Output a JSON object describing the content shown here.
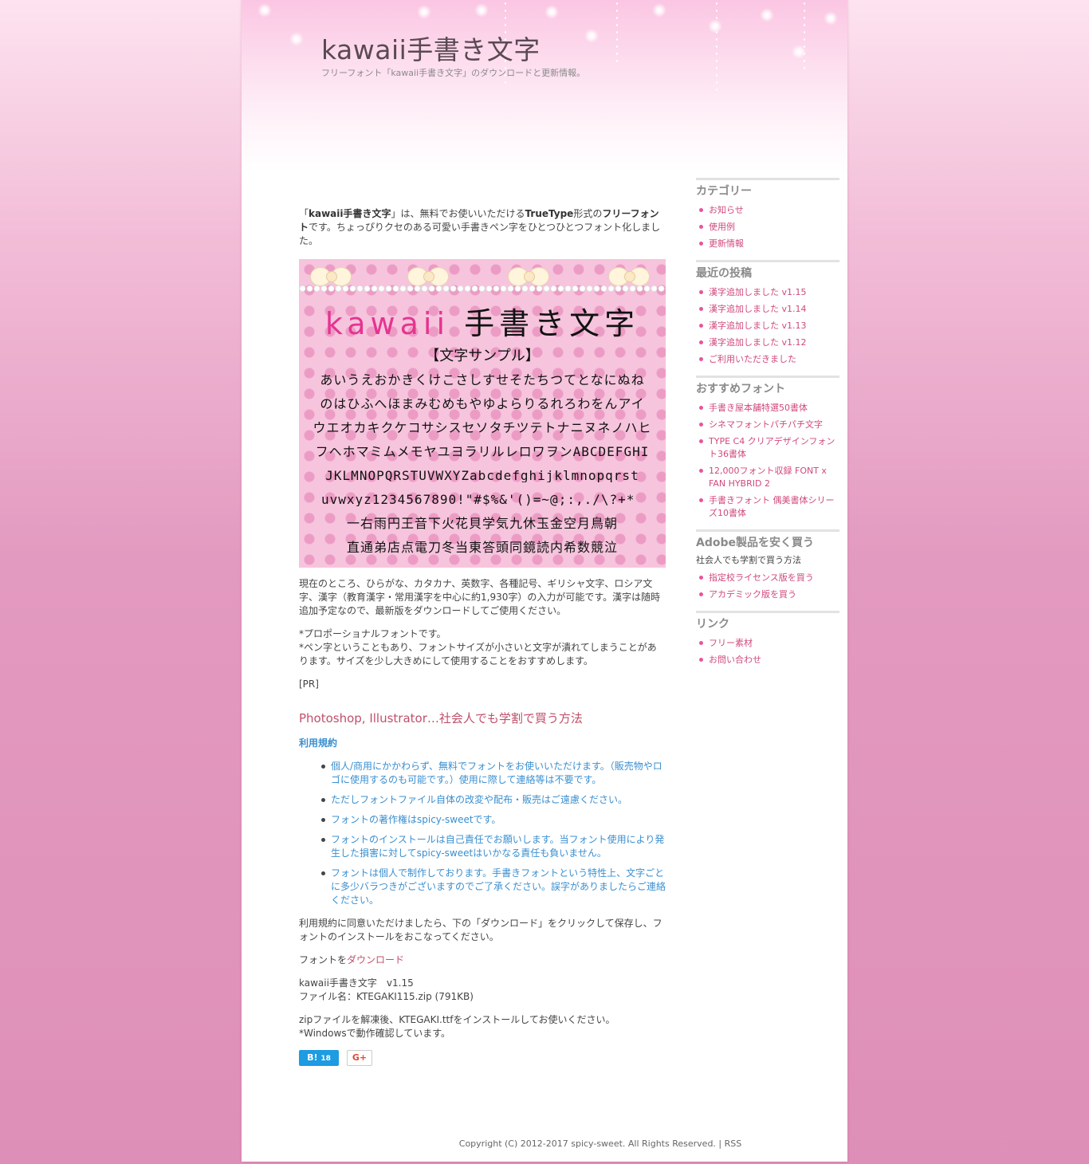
{
  "header": {
    "title": "kawaii手書き文字",
    "description": "フリーフォント「kawaii手書き文字」のダウンロードと更新情報。"
  },
  "intro": {
    "p1_a": "「",
    "p1_b": "kawaii手書き文字",
    "p1_c": "」は、無料でお使いいただける",
    "p1_d": "TrueType",
    "p1_e": "形式の",
    "p1_f": "フリーフォント",
    "p1_g": "です。ちょっぴりクセのある可愛い手書きペン字をひとつひとつフォント化しました。"
  },
  "sample": {
    "title_a": "kawaii",
    "title_b": "手書き文字",
    "subtitle": "【文字サンプル】",
    "lines": [
      "あいうえおかきくけこさしすせそたちつてとなにぬね",
      "のはひふへほまみむめもやゆよらりるれろわをんアイ",
      "ウエオカキクケコサシスセソタチツテトナニヌネノハヒ",
      "フヘホマミムメモヤユヨラリルレロワヲンABCDEFGHI",
      "JKLMNOPQRSTUVWXYZabcdefghijklmnopqrst",
      "uvwxyz1234567890!\"#$%&'()=~@;:,./\\?+*_",
      "一右雨円王音下火花貝学気九休玉金空月鳥朝",
      "直通弟店点電刀冬当東答頭同鏡読内希数競泣"
    ]
  },
  "body": {
    "p2": "現在のところ、ひらがな、カタカナ、英数字、各種記号、ギリシャ文字、ロシア文字、漢字（教育漢字・常用漢字を中心に約1,930字）の入力が可能です。漢字は随時追加予定なので、最新版をダウンロードしてご使用ください。",
    "p3_line1": "*プロポーショナルフォントです。",
    "p3_line2": "*ペン字ということもあり、フォントサイズが小さいと文字が潰れてしまうことがあります。サイズを少し大きめにして使用することをおすすめします。",
    "pr": "[PR]",
    "ad_heading": "Photoshop, Illustrator…社会人でも学割で買う方法",
    "terms_heading": "利用規約",
    "terms": [
      "個人/商用にかかわらず、無料でフォントをお使いいただけます。（販売物やロゴに使用するのも可能です。）使用に際して連絡等は不要です。",
      "ただしフォントファイル自体の改変や配布・販売はご遠慮ください。",
      "フォントの著作権はspicy-sweetです。",
      "フォントのインストールは自己責任でお願いします。当フォント使用により発生した損害に対してspicy-sweetはいかなる責任も負いません。",
      "フォントは個人で制作しております。手書きフォントという特性上、文字ごとに多少バラつきがございますのでご了承ください。誤字がありましたらご連絡ください。"
    ],
    "agree": "利用規約に同意いただけましたら、下の「ダウンロード」をクリックして保存し、フォントのインストールをおこなってください。",
    "download_prefix": "フォントを",
    "download_link": "ダウンロード",
    "version_line": "kawaii手書き文字　v1.15",
    "file_line": "ファイル名：KTEGAKI115.zip (791KB)",
    "install_line1": "zipファイルを解凍後、KTEGAKI.ttfをインストールしてお使いください。",
    "install_line2": "*Windowsで動作確認しています。"
  },
  "social": {
    "hatena_label": "B!",
    "hatena_count": "18",
    "gplus_label": "G+"
  },
  "sidebar": {
    "categories": {
      "title": "カテゴリー",
      "items": [
        "お知らせ",
        "使用例",
        "更新情報"
      ]
    },
    "recent": {
      "title": "最近の投稿",
      "items": [
        "漢字追加しました v1.15",
        "漢字追加しました v1.14",
        "漢字追加しました v1.13",
        "漢字追加しました v1.12",
        "ご利用いただきました"
      ]
    },
    "recommended": {
      "title": "おすすめフォント",
      "items": [
        "手書き屋本舗特選50書体",
        "シネマフォントパチパチ文字",
        "TYPE C4 クリアデザインフォント36書体",
        "12,000フォント収録 FONT x FAN HYBRID 2",
        "手書きフォント 偶美書体シリーズ10書体"
      ]
    },
    "adobe": {
      "title": "Adobe製品を安く買う",
      "note": "社会人でも学割で買う方法",
      "items": [
        "指定校ライセンス版を買う",
        "アカデミック版を買う"
      ]
    },
    "links": {
      "title": "リンク",
      "items": [
        "フリー素材",
        "お問い合わせ"
      ]
    }
  },
  "footer": {
    "copyright": "Copyright (C) 2012-2017 spicy-sweet. All Rights Reserved. | ",
    "rss": "RSS"
  },
  "colors": {
    "accent_pink": "#d0497d",
    "link_blue": "#3a8fd0",
    "heading_red": "#c0506b"
  }
}
